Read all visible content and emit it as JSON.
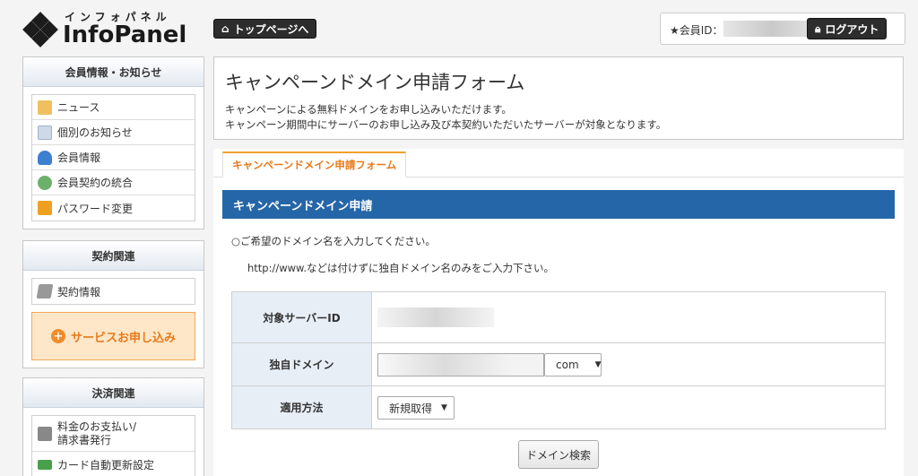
{
  "logo": {
    "kana": "インフォパネル",
    "word": "InfoPanel"
  },
  "header": {
    "top_page_button": "トップページへ",
    "member_id_label": "★会員ID：",
    "logout_button": "ログアウト"
  },
  "sidebar": {
    "member_info": {
      "title": "会員情報・お知らせ",
      "items": [
        {
          "label": "ニュース",
          "icon": "news-icon"
        },
        {
          "label": "個別のお知らせ",
          "icon": "notice-icon"
        },
        {
          "label": "会員情報",
          "icon": "member-icon"
        },
        {
          "label": "会員契約の統合",
          "icon": "merge-icon"
        },
        {
          "label": "パスワード変更",
          "icon": "lock-icon"
        }
      ]
    },
    "contract": {
      "title": "契約関連",
      "items": [
        {
          "label": "契約情報",
          "icon": "contract-icon"
        }
      ],
      "service_button": "サービスお申し込み"
    },
    "payment": {
      "title": "決済関連",
      "items": [
        {
          "label": "料金のお支払い/\n請求書発行",
          "icon": "payment-icon"
        },
        {
          "label": "カード自動更新設定",
          "icon": "card-icon"
        }
      ]
    }
  },
  "main": {
    "title": "キャンペーンドメイン申請フォーム",
    "desc1": "キャンペーンによる無料ドメインをお申し込みいただけます。",
    "desc2": "キャンペーン期間中にサーバーのお申し込み及び本契約いただいたサーバーが対象となります。",
    "tab": "キャンペーンドメイン申請フォーム",
    "section_title": "キャンペーンドメイン申請",
    "instruction1": "○ご希望のドメイン名を入力してください。",
    "instruction2": "http://www.などは付けずに独自ドメイン名のみをご入力下さい。",
    "form": {
      "server_id_label": "対象サーバーID",
      "domain_label": "独自ドメイン",
      "tld_value": "com",
      "method_label": "適用方法",
      "method_value": "新規取得"
    },
    "search_button": "ドメイン検索"
  },
  "colors": {
    "section_bar": "#2566a8",
    "accent": "#e8791a"
  }
}
